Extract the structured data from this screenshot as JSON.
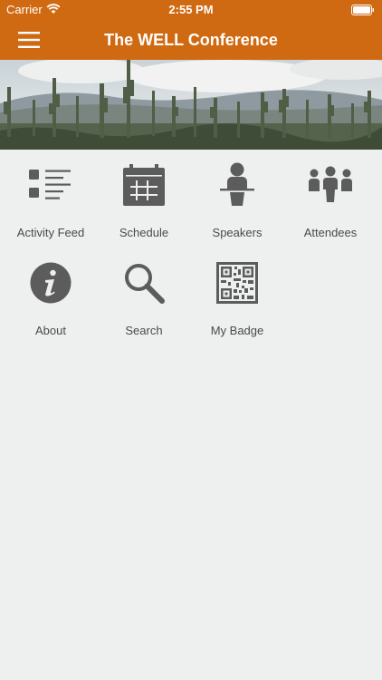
{
  "status_bar": {
    "carrier": "Carrier",
    "time": "2:55 PM"
  },
  "nav": {
    "title": "The WELL Conference",
    "menu_icon": "hamburger-menu-icon"
  },
  "colors": {
    "accent": "#d06a12",
    "background": "#edf0ef",
    "icon": "#5c5c5c",
    "label": "#4a4a4a"
  },
  "menu": {
    "items": [
      {
        "label": "Activity Feed",
        "icon": "activity-feed-icon"
      },
      {
        "label": "Schedule",
        "icon": "calendar-icon"
      },
      {
        "label": "Speakers",
        "icon": "speaker-podium-icon"
      },
      {
        "label": "Attendees",
        "icon": "people-group-icon"
      },
      {
        "label": "About",
        "icon": "info-icon"
      },
      {
        "label": "Search",
        "icon": "search-icon"
      },
      {
        "label": "My Badge",
        "icon": "qr-code-icon"
      }
    ]
  }
}
